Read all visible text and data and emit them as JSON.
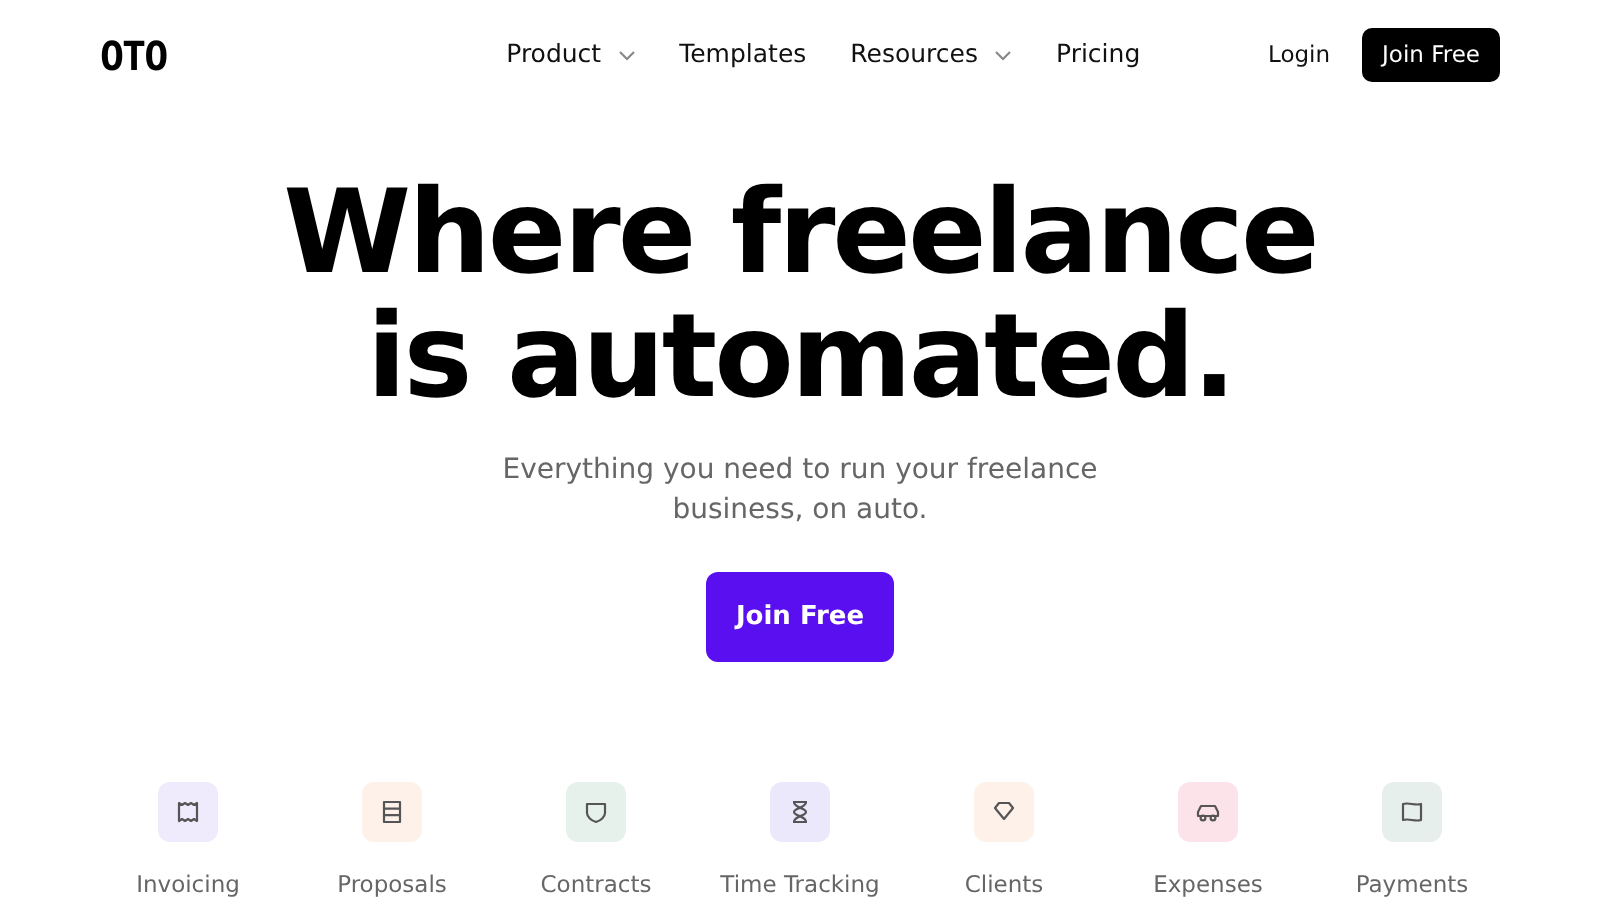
{
  "logo": "OTO",
  "nav": [
    {
      "label": "Product",
      "dropdown": true
    },
    {
      "label": "Templates",
      "dropdown": false
    },
    {
      "label": "Resources",
      "dropdown": true
    },
    {
      "label": "Pricing",
      "dropdown": false
    }
  ],
  "login": "Login",
  "join_button": "Join Free",
  "hero": {
    "title_lines": [
      "Where freelance",
      "is automated."
    ],
    "subtitle_lines": [
      "Everything you need to run your freelance",
      "business, on auto."
    ],
    "cta": "Join Free"
  },
  "features": [
    {
      "label": "Invoicing",
      "kind": "receipt",
      "color": "#efeafc"
    },
    {
      "label": "Proposals",
      "kind": "list",
      "color": "#fdf1ea"
    },
    {
      "label": "Contracts",
      "kind": "shield",
      "color": "#e7f1eb"
    },
    {
      "label": "Time Tracking",
      "kind": "hourglass",
      "color": "#ece8fb"
    },
    {
      "label": "Clients",
      "kind": "diamond",
      "color": "#fdf1ea"
    },
    {
      "label": "Expenses",
      "kind": "car",
      "color": "#fce3ea"
    },
    {
      "label": "Payments",
      "kind": "flag",
      "color": "#e7efec"
    }
  ]
}
